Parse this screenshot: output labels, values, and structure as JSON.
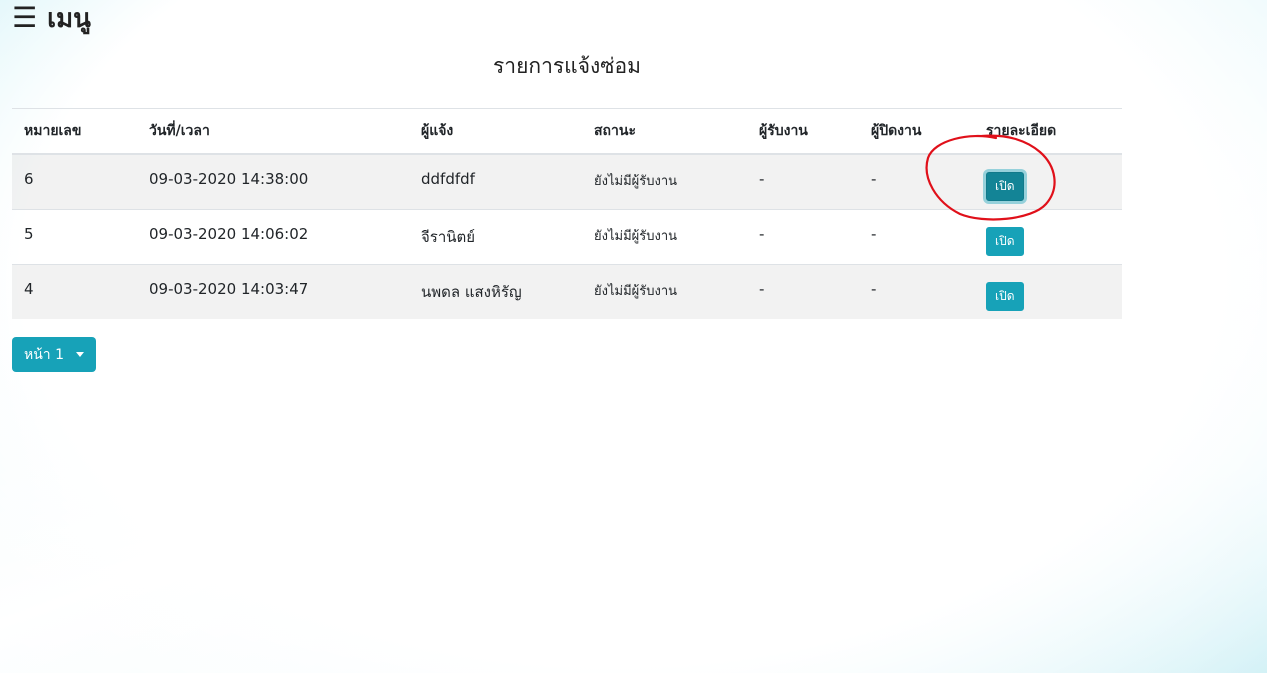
{
  "header": {
    "menu_icon": "☰",
    "menu_label": "เมนู"
  },
  "page": {
    "title": "รายการแจ้งซ่อม"
  },
  "table": {
    "columns": [
      "หมายเลข",
      "วันที่/เวลา",
      "ผู้แจ้ง",
      "สถานะ",
      "ผู้รับงาน",
      "ผู้ปิดงาน",
      "รายละเอียด"
    ],
    "rows": [
      {
        "id": "6",
        "datetime": "09-03-2020 14:38:00",
        "reporter": "ddfdfdf",
        "status": "ยังไม่มีผู้รับงาน",
        "assignee": "-",
        "closer": "-",
        "action": "เปิด"
      },
      {
        "id": "5",
        "datetime": "09-03-2020 14:06:02",
        "reporter": "จีรานิตย์",
        "status": "ยังไม่มีผู้รับงาน",
        "assignee": "-",
        "closer": "-",
        "action": "เปิด"
      },
      {
        "id": "4",
        "datetime": "09-03-2020 14:03:47",
        "reporter": "นพดล แสงหิรัญ",
        "status": "ยังไม่มีผู้รับงาน",
        "assignee": "-",
        "closer": "-",
        "action": "เปิด"
      }
    ]
  },
  "pagination": {
    "label": "หน้า 1"
  },
  "colors": {
    "accent": "#17a2b8",
    "annotation": "#e0101a"
  }
}
